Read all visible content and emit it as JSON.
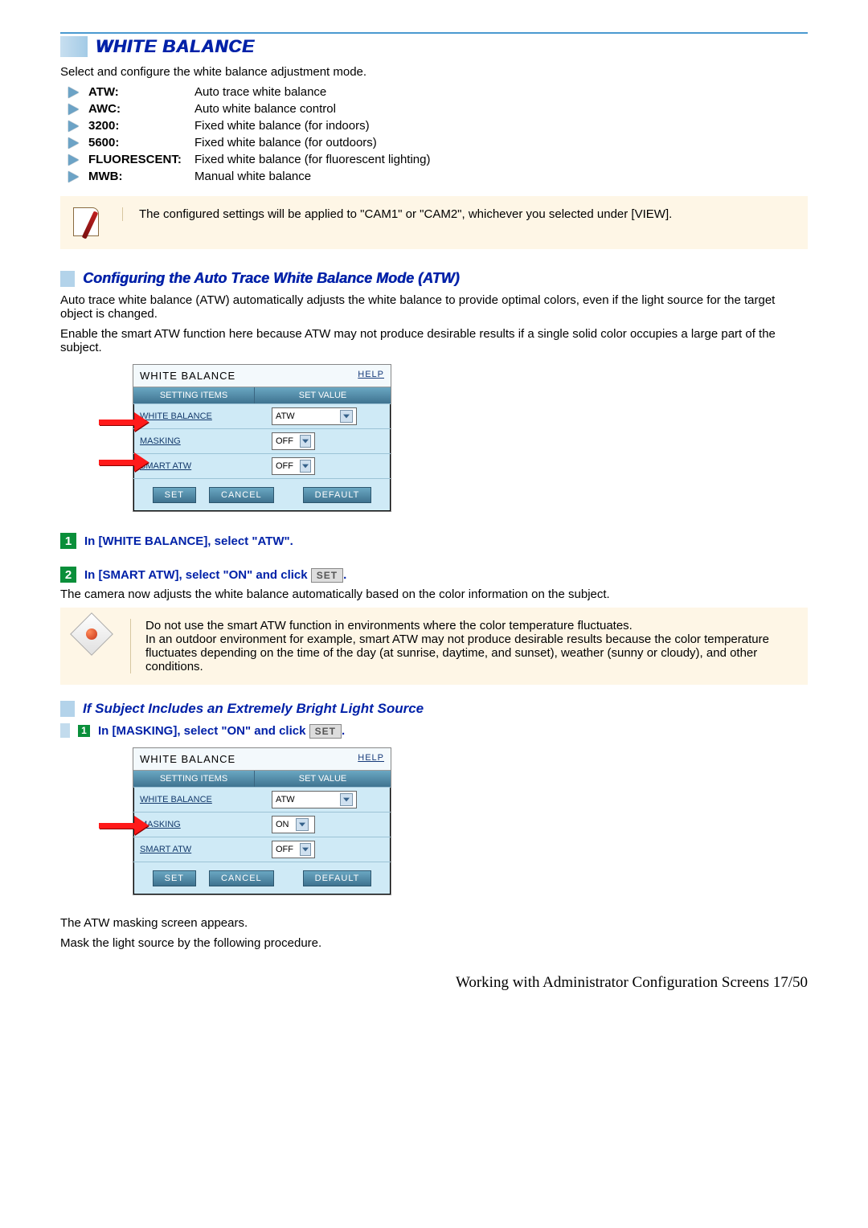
{
  "header": {
    "title": "WHITE BALANCE"
  },
  "intro": "Select and configure the white balance adjustment mode.",
  "modes": [
    {
      "term": "ATW:",
      "desc": "Auto trace white balance"
    },
    {
      "term": "AWC:",
      "desc": "Auto white balance control"
    },
    {
      "term": "3200:",
      "desc": "Fixed white balance (for indoors)"
    },
    {
      "term": "5600:",
      "desc": "Fixed white balance (for outdoors)"
    },
    {
      "term": "FLUORESCENT:",
      "desc": "Fixed white balance (for fluorescent lighting)"
    },
    {
      "term": "MWB:",
      "desc": "Manual white balance"
    }
  ],
  "note1": "The configured settings will be applied to \"CAM1\" or \"CAM2\", whichever you selected under [VIEW].",
  "sub1": {
    "title": "Configuring the Auto Trace White Balance Mode (ATW)",
    "p1": "Auto trace white balance (ATW) automatically adjusts the white balance to provide optimal colors, even if the light source for the target object is changed.",
    "p2": "Enable the smart ATW function here because ATW may not produce desirable results if a single solid color occupies a large part of the subject."
  },
  "panel": {
    "title": "WHITE BALANCE",
    "help": "HELP",
    "col1": "SETTING ITEMS",
    "col2": "SET VALUE",
    "rows": {
      "wb": {
        "label": "WHITE BALANCE",
        "value": "ATW"
      },
      "mask": {
        "label": "MASKING",
        "value": "OFF"
      },
      "smart": {
        "label": "SMART ATW",
        "value": "OFF"
      }
    },
    "btns": {
      "set": "SET",
      "cancel": "CANCEL",
      "default": "DEFAULT"
    }
  },
  "step1": {
    "num": "1",
    "text": "In [WHITE BALANCE], select \"ATW\"."
  },
  "step2": {
    "num": "2",
    "pre": "In [SMART ATW], select \"ON\" and click ",
    "btn": "SET",
    "post": "."
  },
  "step2_follow": "The camera now adjusts the white balance automatically based on the color information on the subject.",
  "warn": {
    "l1": "Do not use the smart ATW function in environments where the color temperature fluctuates.",
    "l2": "In an outdoor environment for example, smart ATW may not produce desirable results because the color temperature fluctuates depending on the time of the day (at sunrise, daytime, and sunset), weather (sunny or cloudy), and other conditions."
  },
  "sub2": {
    "title": "If Subject Includes an Extremely Bright Light Source",
    "step": {
      "num": "1",
      "pre": "In [MASKING], select \"ON\" and click ",
      "btn": "SET",
      "post": "."
    }
  },
  "panel2": {
    "rows": {
      "wb": {
        "label": "WHITE BALANCE",
        "value": "ATW"
      },
      "mask": {
        "label": "MASKING",
        "value": "ON"
      },
      "smart": {
        "label": "SMART ATW",
        "value": "OFF"
      }
    }
  },
  "tail": {
    "p1": "The ATW masking screen appears.",
    "p2": "Mask the light source by the following procedure."
  },
  "footer": "Working with Administrator Configuration Screens 17/50"
}
